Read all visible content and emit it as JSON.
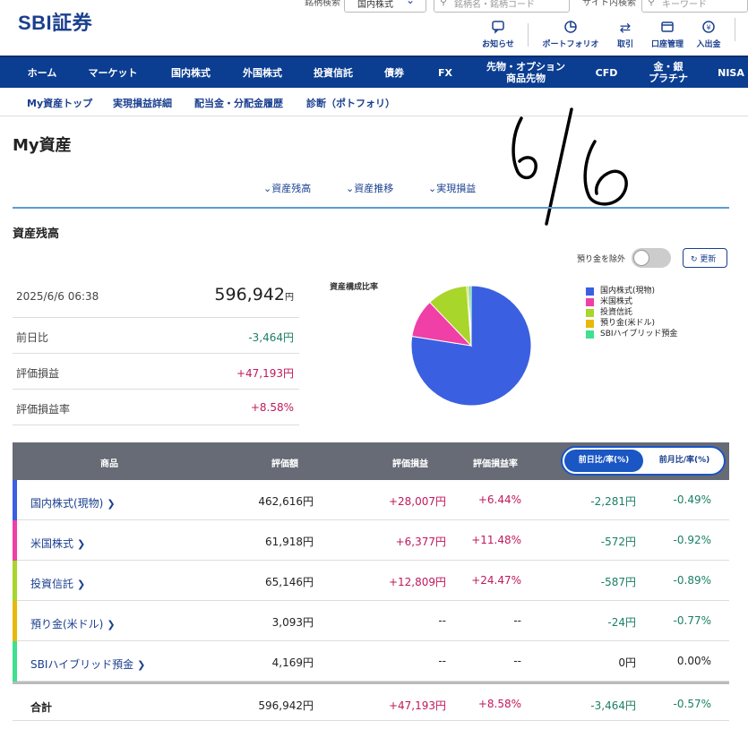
{
  "header": {
    "logo": "SBI証券",
    "search_type_label": "銘柄検索",
    "search_type_value": "国内株式",
    "search_placeholder": "銘柄名・銘柄コード",
    "site_search_label": "サイト内検索",
    "site_search_placeholder": "キーワード",
    "icons": [
      {
        "label": "お知らせ",
        "icon": "chat-bubble-icon"
      },
      {
        "label": "ポートフォリオ",
        "icon": "pie-chart-icon"
      },
      {
        "label": "取引",
        "icon": "swap-arrows-icon"
      },
      {
        "label": "口座管理",
        "icon": "wallet-icon"
      },
      {
        "label": "入出金",
        "icon": "yen-coin-icon"
      }
    ]
  },
  "nav": [
    "ホーム",
    "マーケット",
    "国内株式",
    "外国株式",
    "投資信託",
    "債券",
    "FX",
    "先物・オプション\n商品先物",
    "CFD",
    "金・銀\nプラチナ",
    "NISA"
  ],
  "subnav": [
    "My資産トップ",
    "実現損益詳細",
    "配当金・分配金履歴",
    "診断（ポトフォリ）"
  ],
  "page_title": "My資産",
  "anchors": [
    "資産残高",
    "資産推移",
    "実現損益"
  ],
  "section_title": "資産残高",
  "toggle_label": "預り金を除外",
  "refresh_label": "更新",
  "summary": {
    "datetime": "2025/6/6 06:38",
    "total": "596,942",
    "yen": "円",
    "rows": [
      {
        "label": "前日比",
        "value": "-3,464円",
        "color": "green"
      },
      {
        "label": "評価損益",
        "value": "+47,193円",
        "color": "red"
      },
      {
        "label": "評価損益率",
        "value": "+8.58%",
        "color": "red"
      }
    ]
  },
  "chart_data": {
    "type": "pie",
    "title": "資産構成比率",
    "categories": [
      "国内株式(現物)",
      "米国株式",
      "投資信託",
      "預り金(米ドル)",
      "SBIハイブリッド預金"
    ],
    "values": [
      462616,
      61918,
      65146,
      3093,
      4169
    ],
    "colors": [
      "#3a5fe0",
      "#f03fa6",
      "#a8d62a",
      "#e8b90c",
      "#3fe08f"
    ],
    "legend": "right"
  },
  "table": {
    "headers": [
      "商品",
      "評価額",
      "評価損益",
      "評価損益率"
    ],
    "toggle_on": "前日比/率(%)",
    "toggle_off": "前月比/率(%)",
    "rows": [
      {
        "name": "国内株式(現物)",
        "amount": "462,616円",
        "pl": "+28,007円",
        "rate": "+6.44%",
        "diff": "-2,281円",
        "diff_rate": "-0.49%",
        "color": "#3a5fe0"
      },
      {
        "name": "米国株式",
        "amount": "61,918円",
        "pl": "+6,377円",
        "rate": "+11.48%",
        "diff": "-572円",
        "diff_rate": "-0.92%",
        "color": "#f03fa6"
      },
      {
        "name": "投資信託",
        "amount": "65,146円",
        "pl": "+12,809円",
        "rate": "+24.47%",
        "diff": "-587円",
        "diff_rate": "-0.89%",
        "color": "#a8d62a"
      },
      {
        "name": "預り金(米ドル)",
        "amount": "3,093円",
        "pl": "--",
        "rate": "--",
        "diff": "-24円",
        "diff_rate": "-0.77%",
        "color": "#e8b90c"
      },
      {
        "name": "SBIハイブリッド預金",
        "amount": "4,169円",
        "pl": "--",
        "rate": "--",
        "diff": "0円",
        "diff_rate": "0.00%",
        "color": "#3fe08f"
      }
    ],
    "total": {
      "name": "合計",
      "amount": "596,942円",
      "pl": "+47,193円",
      "rate": "+8.58%",
      "diff": "-3,464円",
      "diff_rate": "-0.57%"
    }
  },
  "handwritten": "6/6"
}
